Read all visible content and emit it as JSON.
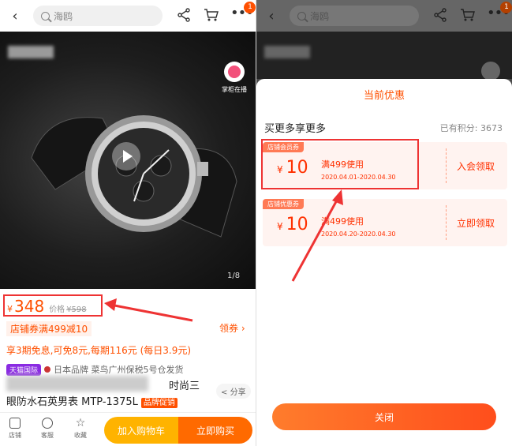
{
  "left": {
    "search_text": "海鸥",
    "cart_badge": "1",
    "live_label": "掌柜在播",
    "image_counter": "1/8",
    "price": {
      "currency": "¥",
      "current": "348",
      "orig_label": "价格",
      "orig": "¥598"
    },
    "coupon_tag": "店铺券满499减10",
    "coupon_link": "领券 ›",
    "installment": "享3期免息,可免8元,每期116元 (每日3.9元)",
    "tmall_label": "天猫国际",
    "origin_text": "日本品牌 菜鸟广州保税5号仓发货",
    "title_line1": "时尚三",
    "title_line2": "眼防水石英男表 MTP-1375L",
    "promo_label": "品牌促销",
    "share_label": "分享",
    "nav": [
      {
        "label": "店铺",
        "icon": "store-icon"
      },
      {
        "label": "客服",
        "icon": "service-icon"
      },
      {
        "label": "收藏",
        "icon": "star-icon"
      }
    ],
    "add_cart_label": "加入购物车",
    "buy_now_label": "立即购买"
  },
  "right": {
    "search_text": "海鸥",
    "cart_badge": "1",
    "sheet_title": "当前优惠",
    "sheet_subtitle": "买更多享更多",
    "points_label": "已有积分:",
    "points_value": "3673",
    "coupons": [
      {
        "tag": "店铺会员券",
        "currency": "¥",
        "amount": "10",
        "condition": "满499使用",
        "date": "2020.04.01-2020.04.30",
        "action": "入会领取"
      },
      {
        "tag": "店铺优惠券",
        "currency": "¥",
        "amount": "10",
        "condition": "满499使用",
        "date": "2020.04.20-2020.04.30",
        "action": "立即领取"
      }
    ],
    "close_label": "关闭"
  },
  "colors": {
    "accent": "#ff5000",
    "highlight": "#e33333"
  }
}
